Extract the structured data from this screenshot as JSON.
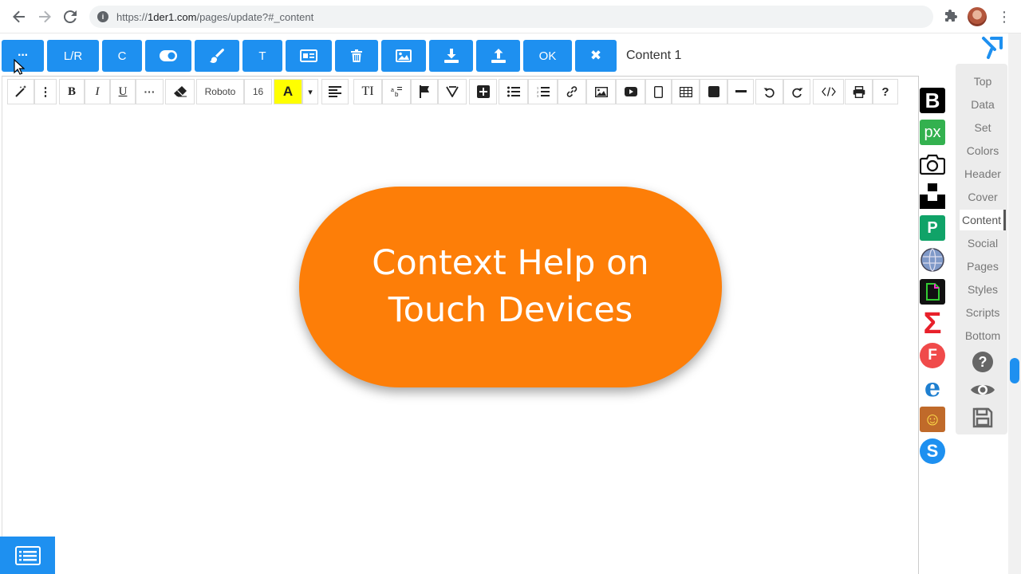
{
  "browser": {
    "url_prefix": "https://",
    "url_host": "1der1.com",
    "url_path": "/pages/update?#_content"
  },
  "toolbar": {
    "more_label": "···",
    "lr_label": "L/R",
    "c_label": "C",
    "t_label": "T",
    "ok_label": "OK",
    "close_label": "✖",
    "section_label": "Content 1",
    "accent_color": "#1e90f0"
  },
  "format_bar": {
    "bold": "B",
    "italic": "I",
    "underline": "U",
    "more": "···",
    "font_name": "Roboto",
    "font_size": "16",
    "color_a": "A",
    "caret": "▾",
    "text_size": "TI",
    "help": "?"
  },
  "content": {
    "pill_text": "Context Help on Touch Devices",
    "pill_color": "#fd7e08"
  },
  "side_icons": [
    {
      "name": "b-icon",
      "label": "B",
      "color": "#000000"
    },
    {
      "name": "px-icon",
      "label": "px",
      "color": "#33b14f"
    },
    {
      "name": "camera-icon",
      "label": "",
      "color": "#ffffff"
    },
    {
      "name": "unsplash-icon",
      "label": "",
      "color": "#000000"
    },
    {
      "name": "p-icon",
      "label": "P",
      "color": "#10a368"
    },
    {
      "name": "globe-icon",
      "label": "",
      "color": "#6b87b8"
    },
    {
      "name": "file-icon",
      "label": "",
      "color": "#111111"
    },
    {
      "name": "sigma-icon",
      "label": "Σ",
      "color": "#ffffff"
    },
    {
      "name": "f-icon",
      "label": "F",
      "color": "#f04a4a"
    },
    {
      "name": "ie-icon",
      "label": "e",
      "color": "#ffffff"
    },
    {
      "name": "emoji-book-icon",
      "label": "☺",
      "color": "#c06a2a"
    },
    {
      "name": "skype-icon",
      "label": "S",
      "color": "#1e90f0"
    }
  ],
  "nav": {
    "items": [
      "Top",
      "Data",
      "Set",
      "Colors",
      "Header",
      "Cover",
      "Content",
      "Social",
      "Pages",
      "Styles",
      "Scripts",
      "Bottom"
    ],
    "active": "Content"
  }
}
